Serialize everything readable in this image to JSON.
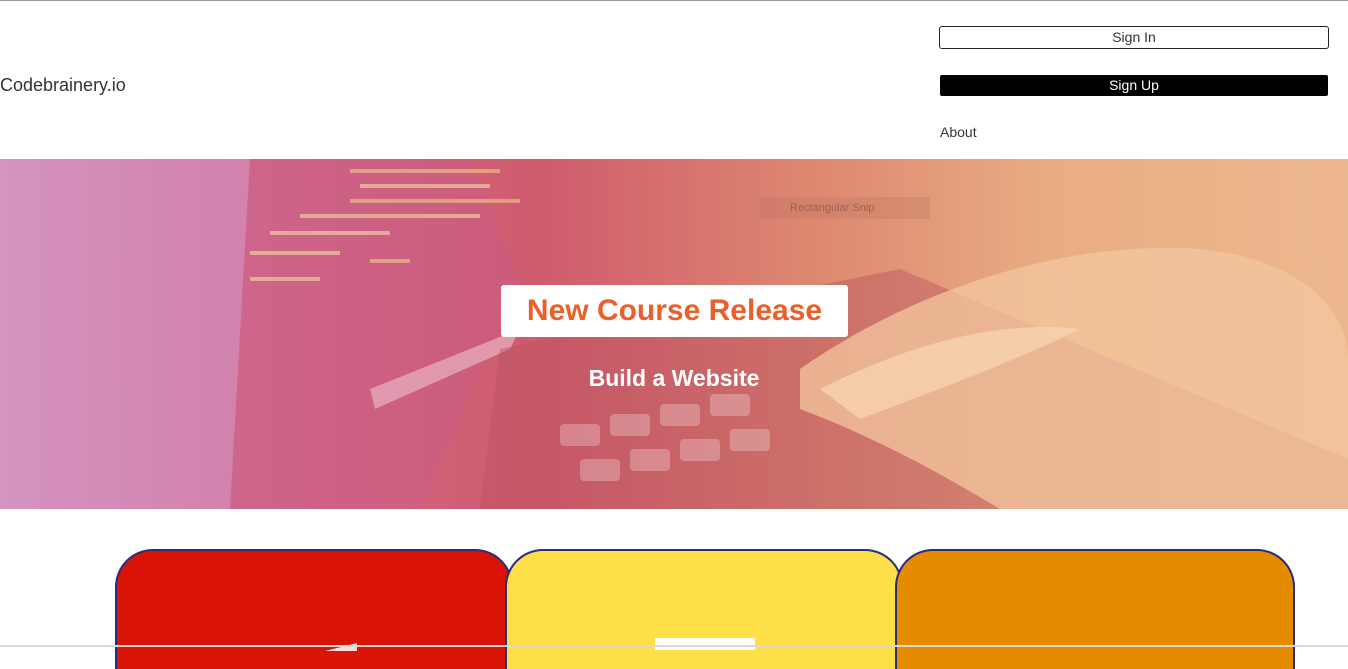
{
  "header": {
    "brand": "Codebrainery.io",
    "sign_in_label": "Sign In",
    "sign_up_label": "Sign Up",
    "about_label": "About"
  },
  "hero": {
    "snip_label": "Rectangular Snip",
    "title": "New Course Release",
    "subtitle": "Build a Website"
  },
  "colors": {
    "accent": "#ec5f2b",
    "card_red": "#d91406",
    "card_yellow": "#fde047",
    "card_orange": "#e58b00",
    "card_border": "#2a2c7c"
  }
}
